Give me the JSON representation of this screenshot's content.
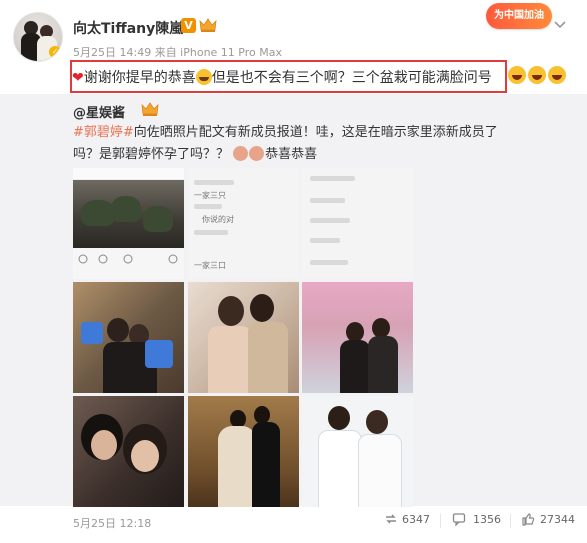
{
  "header": {
    "username": "向太Tiffany陳嵐",
    "vip_badge": "V",
    "meta": "5月25日 14:49 来自 iPhone 11 Pro Max",
    "campaign_label": "为中国加油"
  },
  "post": {
    "text": "谢谢你提早的恭喜",
    "text_mid": "但是也不会有三个啊？三个盆栽可能满脸问号"
  },
  "repost": {
    "author": "@星娱酱",
    "hashtag": "#郭碧婷#",
    "text": "向佐晒照片配文有新成员报道！哇，这是在暗示家里添新成员了吗？是郭碧婷怀孕了吗？？",
    "congrats": "恭喜恭喜",
    "tile2": {
      "line1": "一家三只",
      "line2": "你说的对",
      "line3": "一家三口"
    }
  },
  "footer": {
    "date": "5月25日 12:18",
    "reposts": "6347",
    "comments": "1356",
    "likes": "27344"
  },
  "colors": {
    "accent_orange": "#eb7350",
    "highlight_box": "#e03a3a",
    "vip_orange": "#f29100"
  }
}
